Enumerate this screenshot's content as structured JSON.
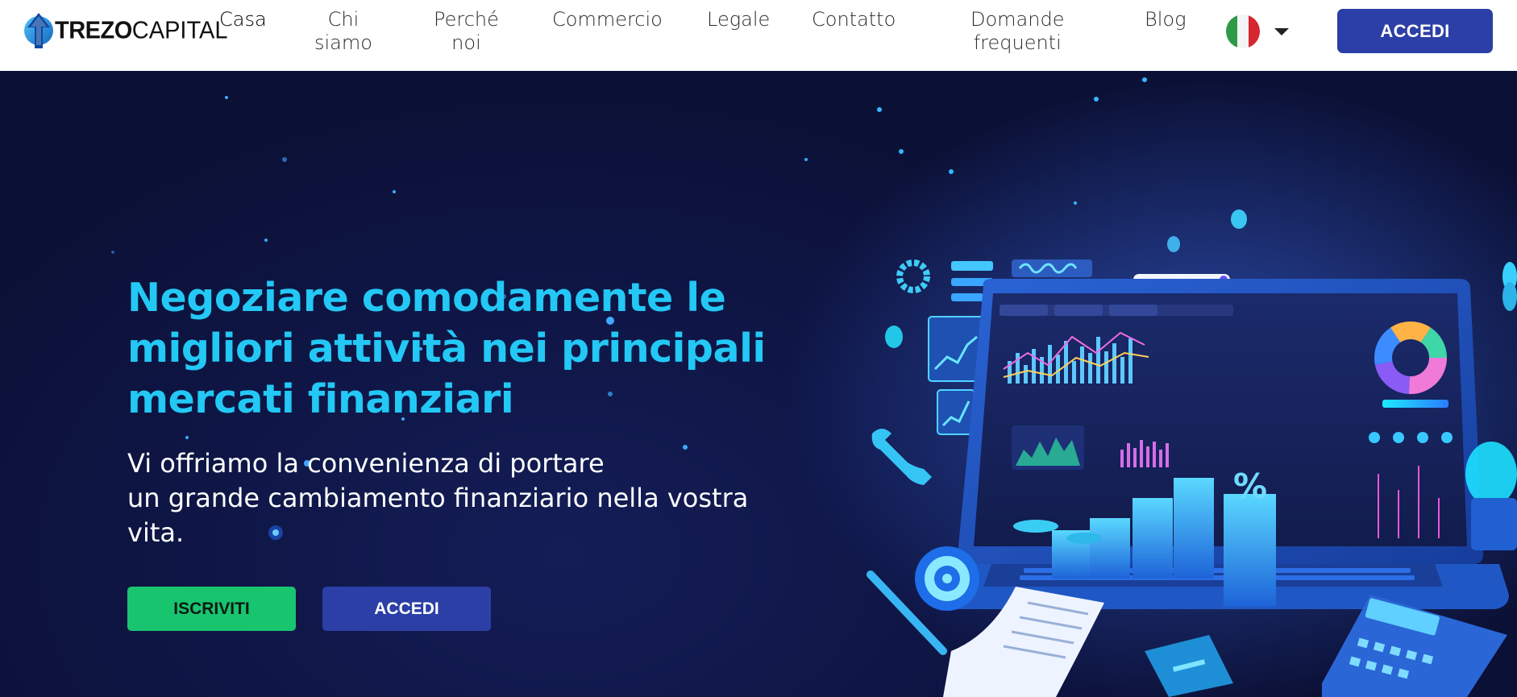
{
  "brand": {
    "name_bold": "TREZO",
    "name_light": "CAPITAL",
    "colors": {
      "primary": "#2c3fa6",
      "accent": "#23c8f5",
      "success": "#19c46f"
    }
  },
  "nav": {
    "items": [
      {
        "label": "Casa",
        "active": true
      },
      {
        "label": "Chi\nsiamo"
      },
      {
        "label": "Perché\nnoi"
      },
      {
        "label": "Commercio"
      },
      {
        "label": "Legale"
      },
      {
        "label": "Contatto"
      },
      {
        "label": "Domande\nfrequenti"
      },
      {
        "label": "Blog"
      }
    ],
    "language_flag": "italy-flag-icon",
    "login_label": "ACCEDI"
  },
  "hero": {
    "title": "Negoziare comodamente le migliori attività nei principali mercati finanziari",
    "subtitle": "Vi offriamo la convenienza di portare\nun grande cambiamento finanziario nella vostra\nvita.",
    "signup_label": "ISCRIVITI",
    "login_label": "ACCEDI",
    "illustration": "laptop-financial-dashboard-illustration"
  }
}
